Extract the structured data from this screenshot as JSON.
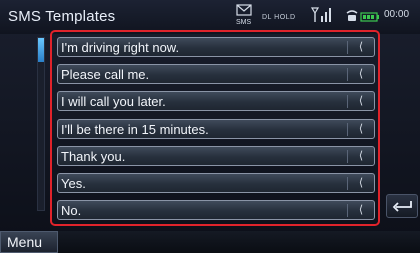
{
  "title": "SMS Templates",
  "status_bar": {
    "sms_label": "SMS",
    "dl_hold_label": "DL HOLD",
    "clock": "00:00"
  },
  "templates": [
    {
      "label": "I'm driving right now."
    },
    {
      "label": "Please call me."
    },
    {
      "label": "I will call you later."
    },
    {
      "label": "I'll be there in 15 minutes."
    },
    {
      "label": "Thank you."
    },
    {
      "label": "Yes."
    },
    {
      "label": "No."
    }
  ],
  "item_edit_icon": "back-arrow-icon",
  "menu_label": "Menu",
  "colors": {
    "highlight_border": "#e0232b",
    "scroll_thumb": "#4aa8f0",
    "text": "#f2f5fa"
  }
}
